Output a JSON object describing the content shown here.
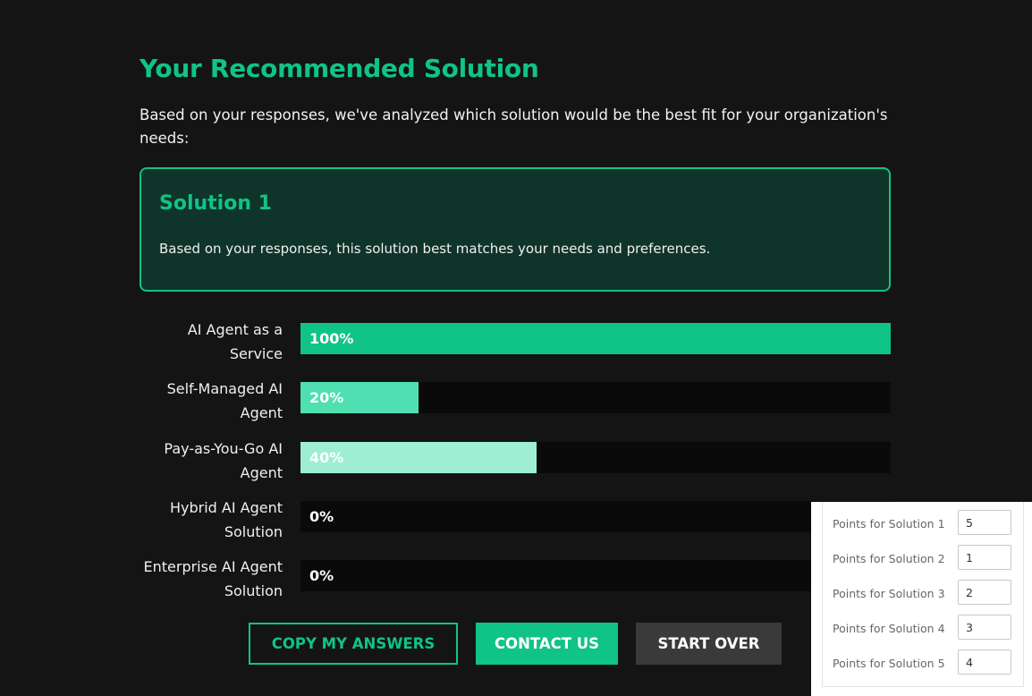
{
  "header": {
    "title": "Your Recommended Solution",
    "intro": "Based on your responses, we've analyzed which solution would be the best fit for your organization's needs:"
  },
  "recommendation": {
    "title": "Solution 1",
    "description": "Based on your responses, this solution best matches your needs and preferences."
  },
  "scores": [
    {
      "label_line1": "AI Agent as a",
      "label_line2": "Service",
      "percent_text": "100%",
      "percent": 100,
      "color": "#10c387"
    },
    {
      "label_line1": "Self-Managed AI",
      "label_line2": "Agent",
      "percent_text": "20%",
      "percent": 20,
      "color": "#4fdfb1"
    },
    {
      "label_line1": "Pay-as-You-Go AI",
      "label_line2": "Agent",
      "percent_text": "40%",
      "percent": 40,
      "color": "#9deed3"
    },
    {
      "label_line1": "Hybrid AI Agent",
      "label_line2": "Solution",
      "percent_text": "0%",
      "percent": 0,
      "color": "#10c387"
    },
    {
      "label_line1": "Enterprise AI Agent",
      "label_line2": "Solution",
      "percent_text": "0%",
      "percent": 0,
      "color": "#10c387"
    }
  ],
  "actions": {
    "copy_label": "COPY MY ANSWERS",
    "contact_label": "CONTACT US",
    "start_over_label": "START OVER"
  },
  "points_panel": [
    {
      "label": "Points for Solution 1",
      "value": "5"
    },
    {
      "label": "Points for Solution 2",
      "value": "1"
    },
    {
      "label": "Points for Solution 3",
      "value": "2"
    },
    {
      "label": "Points for Solution 4",
      "value": "3"
    },
    {
      "label": "Points for Solution 5",
      "value": "4"
    }
  ],
  "colors": {
    "accent": "#10c387",
    "background": "#141414",
    "card_background": "#0f342a",
    "track": "#0a0a0a",
    "secondary_button": "#3a3a3a"
  }
}
